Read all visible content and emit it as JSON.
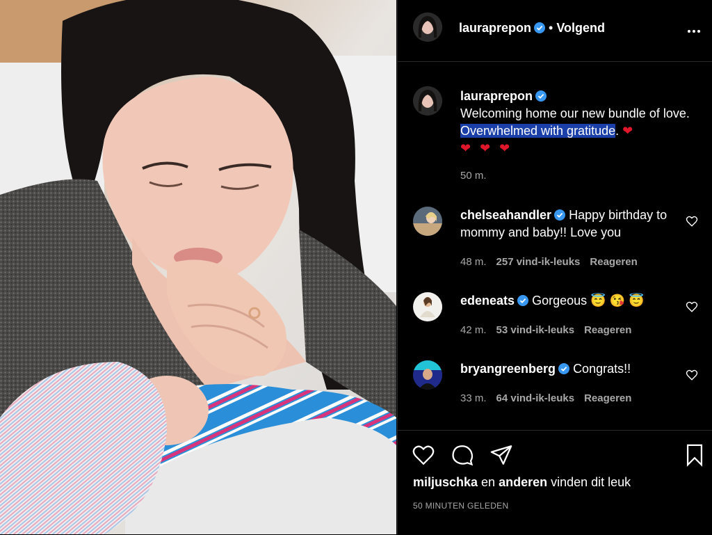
{
  "post": {
    "photo_alt": "Mother kissing newborn's hand",
    "owner_username": "lauraprepon",
    "follow_separator": "•",
    "follow_label": "Volgend"
  },
  "caption": {
    "username": "lauraprepon",
    "text_before": "Welcoming home our new bundle of love. ",
    "text_highlight": "Overwhelmed with gratitude",
    "text_after": ". ",
    "hearts_inline": "❤",
    "hearts_line": "❤ ❤ ❤",
    "time": "50 m."
  },
  "comments": [
    {
      "username": "chelseahandler",
      "text": "Happy birthday to mommy and baby!! Love you",
      "time": "48 m.",
      "likes": "257 vind-ik-leuks",
      "reply": "Reageren"
    },
    {
      "username": "edeneats",
      "text": "Gorgeous 😇 😘 😇",
      "time": "42 m.",
      "likes": "53 vind-ik-leuks",
      "reply": "Reageren"
    },
    {
      "username": "bryangreenberg",
      "text": "Congrats!!",
      "time": "33 m.",
      "likes": "64 vind-ik-leuks",
      "reply": "Reageren"
    }
  ],
  "footer": {
    "liked_by_user": "miljuschka",
    "liked_by_mid": " en ",
    "liked_by_others": "anderen",
    "liked_by_end": " vinden dit leuk",
    "time_ago": "50 MINUTEN GELEDEN"
  },
  "icons": {
    "verified": "verified-badge-icon",
    "more": "more-options-icon",
    "like": "heart-icon",
    "comment": "comment-icon",
    "share": "paper-plane-icon",
    "save": "bookmark-icon"
  },
  "colors": {
    "background": "#000000",
    "verified": "#3897f0",
    "highlight": "#1a3fa8",
    "heart": "#e0162b",
    "muted": "#a8a8a8"
  }
}
